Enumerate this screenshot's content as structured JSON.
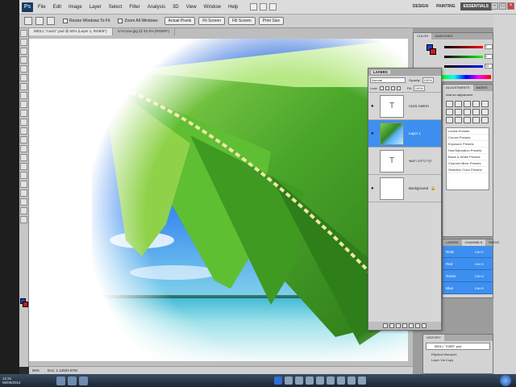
{
  "menu": {
    "items": [
      "File",
      "Edit",
      "Image",
      "Layer",
      "Select",
      "Filter",
      "Analysis",
      "3D",
      "View",
      "Window",
      "Help"
    ]
  },
  "workspace": {
    "items": [
      "DESIGN",
      "PAINTING",
      "ESSENTIALS"
    ],
    "active": "ESSENTIALS"
  },
  "options": {
    "resize_windows": "Resize Windows To Fit",
    "zoom_all_windows": "Zoom All Windows",
    "actual_pixels": "Actual Pixels",
    "fit_screen": "Fit Screen",
    "fill_screen": "Fill Screen",
    "print_size": "Print Size"
  },
  "tabs": [
    {
      "label": "58011 \"תמונה\".psd @ 50% (Layer 1, RGB/8*)",
      "active": true
    },
    {
      "label": "אמבטיה1.jpg @ 33.3% (RGB/8*)",
      "active": false
    }
  ],
  "status": {
    "zoom": "50%",
    "doc": "Doc: 1.12M/4.97M"
  },
  "layers_panel": {
    "title": "LAYERS",
    "blend_mode": "Normal",
    "opacity_label": "Opacity:",
    "opacity": "100%",
    "lock_label": "Lock:",
    "fill_label": "Fill:",
    "fill": "100%",
    "layers": [
      {
        "name": "חופשה מהנה",
        "type": "text",
        "visible": true,
        "selected": false
      },
      {
        "name": "Layer 1",
        "type": "image",
        "visible": true,
        "selected": true
      },
      {
        "name": "דף כריכה ראשי",
        "type": "text",
        "visible": false,
        "selected": false
      },
      {
        "name": "Background",
        "type": "background",
        "visible": true,
        "selected": false,
        "locked": true
      }
    ]
  },
  "color_panel": {
    "tabs": [
      "COLOR",
      "SWATCHES"
    ],
    "r": "0",
    "g": "0",
    "b": "34",
    "foreground": "#1a46c8",
    "background": "#d01818"
  },
  "adjustments_panel": {
    "tabs": [
      "ADJUSTMENTS",
      "MASKS"
    ],
    "title": "Add an adjustment",
    "presets": [
      "Levels Presets",
      "Curves Presets",
      "Exposure Presets",
      "Hue/Saturation Presets",
      "Black & White Presets",
      "Channel Mixer Presets",
      "Selective Color Presets"
    ]
  },
  "channels_panel": {
    "tabs": [
      "LAYERS",
      "CHANNELS",
      "PATHS"
    ],
    "channels": [
      {
        "name": "RGB",
        "shortcut": "Ctrl+2"
      },
      {
        "name": "Red",
        "shortcut": "Ctrl+3"
      },
      {
        "name": "Green",
        "shortcut": "Ctrl+4"
      },
      {
        "name": "Blue",
        "shortcut": "Ctrl+5"
      }
    ]
  },
  "history_panel": {
    "title": "HISTORY",
    "snapshot": "58011 \"תמונה\".psd",
    "items": [
      "Elliptical Marquee",
      "Layer Via Copy"
    ]
  },
  "taskbar": {
    "time": "12:31",
    "date": "05/06/2012"
  },
  "colors": {
    "selection": "#3d8ff0",
    "taskbar": "#1b2634"
  }
}
